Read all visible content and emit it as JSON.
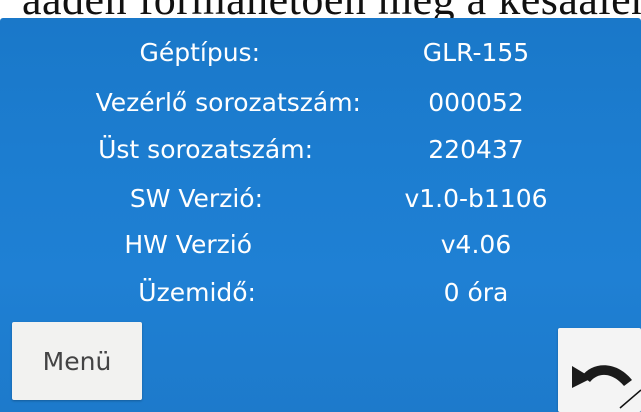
{
  "caption": "aaden formánetoen meg a kesaáleh ada",
  "info": {
    "machine_type_label": "Géptípus:",
    "machine_type_value": "GLR-155",
    "controller_serial_label": "Vezérlő sorozatszám:",
    "controller_serial_value": "000052",
    "tank_serial_label": "Üst sorozatszám:",
    "tank_serial_value": "220437",
    "sw_version_label": "SW Verzió:",
    "sw_version_value": "v1.0-b1106",
    "hw_version_label": "HW Verzió",
    "hw_version_value": "v4.06",
    "operating_time_label": "Üzemidő:",
    "operating_time_value": "0 óra"
  },
  "buttons": {
    "menu_label": "Menü",
    "back_icon": "undo-arrow-icon"
  },
  "colors": {
    "screen_blue": "#1c7dd0",
    "text": "#ffffff"
  }
}
